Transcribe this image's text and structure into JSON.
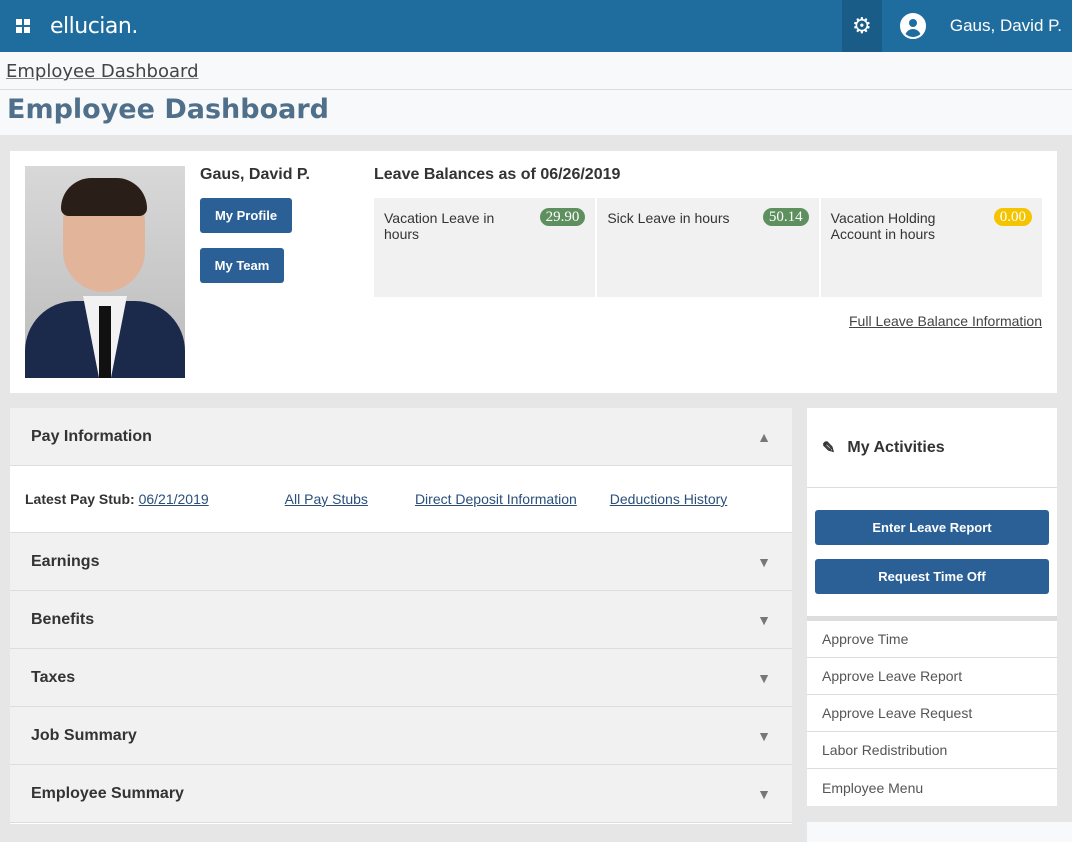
{
  "header": {
    "logo": "ellucian.",
    "user_name": "Gaus, David P."
  },
  "breadcrumb": "Employee Dashboard",
  "page_title": "Employee Dashboard",
  "profile": {
    "name": "Gaus, David P.",
    "my_profile": "My Profile",
    "my_team": "My Team"
  },
  "leave": {
    "title": "Leave Balances as of 06/26/2019",
    "items": [
      {
        "label": "Vacation Leave in hours",
        "value": "29.90",
        "color": "#5e8f5e"
      },
      {
        "label": "Sick Leave in hours",
        "value": "50.14",
        "color": "#5e8f5e"
      },
      {
        "label": "Vacation Holding Account in hours",
        "value": "0.00",
        "color": "#f5c400"
      }
    ],
    "full_link": "Full Leave Balance Information"
  },
  "pay": {
    "title": "Pay Information",
    "latest_label": "Latest Pay Stub:",
    "latest_date": "06/21/2019",
    "links": [
      "All Pay Stubs",
      "Direct Deposit Information",
      "Deductions History"
    ]
  },
  "sections": [
    "Earnings",
    "Benefits",
    "Taxes",
    "Job Summary",
    "Employee Summary"
  ],
  "activities": {
    "title": "My Activities",
    "buttons": [
      "Enter Leave Report",
      "Request Time Off"
    ],
    "links": [
      "Approve Time",
      "Approve Leave Report",
      "Approve Leave Request",
      "Labor Redistribution",
      "Employee Menu"
    ]
  }
}
